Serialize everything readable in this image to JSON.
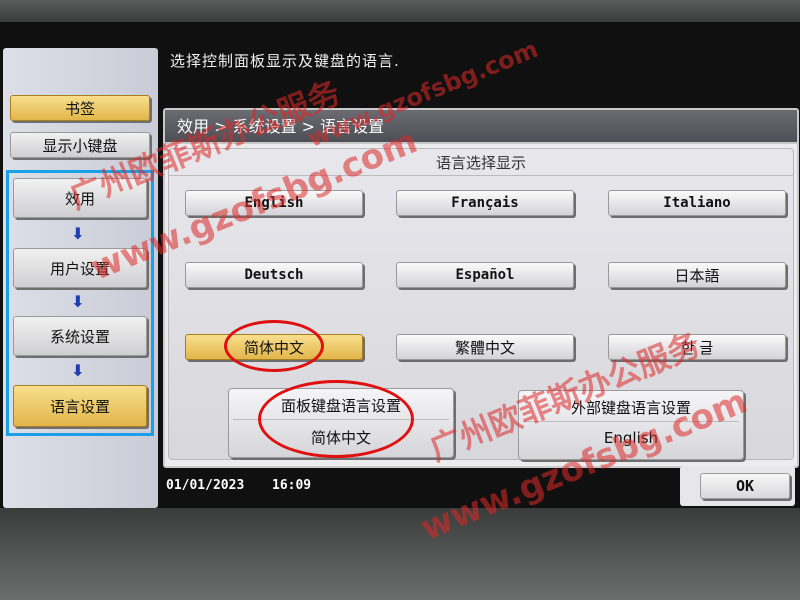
{
  "instruction": "选择控制面板显示及键盘的语言.",
  "sidebar": {
    "bookmark_label": "书签",
    "keypad_label": "显示小键盘",
    "flow_items": [
      "效用",
      "用户设置",
      "系统设置",
      "语言设置"
    ],
    "arrow_glyph": "⬇"
  },
  "breadcrumb": "效用 > 系统设置 > 语言设置",
  "language_section": {
    "title": "语言选择显示",
    "buttons": [
      "English",
      "Français",
      "Italiano",
      "Deutsch",
      "Español",
      "日本語",
      "简体中文",
      "繁體中文",
      "한 글"
    ],
    "selected": "简体中文"
  },
  "panel_keyboard": {
    "label": "面板键盘语言设置",
    "value": "简体中文"
  },
  "external_keyboard": {
    "label": "外部键盘语言设置",
    "value": "English"
  },
  "status_bar": {
    "date": "01/01/2023",
    "time": "16:09"
  },
  "ok_label": "OK",
  "watermarks": [
    "广州欧菲斯办公服务",
    "www.gzofsbg.com",
    "广州欧菲斯办公服务",
    "www.gzofsbg.com",
    "www.gzofsbg.com"
  ],
  "colors": {
    "highlight_frame": "#1aa0e6",
    "annotation_circle": "#e01010",
    "selected_button": "#e2b64a"
  }
}
